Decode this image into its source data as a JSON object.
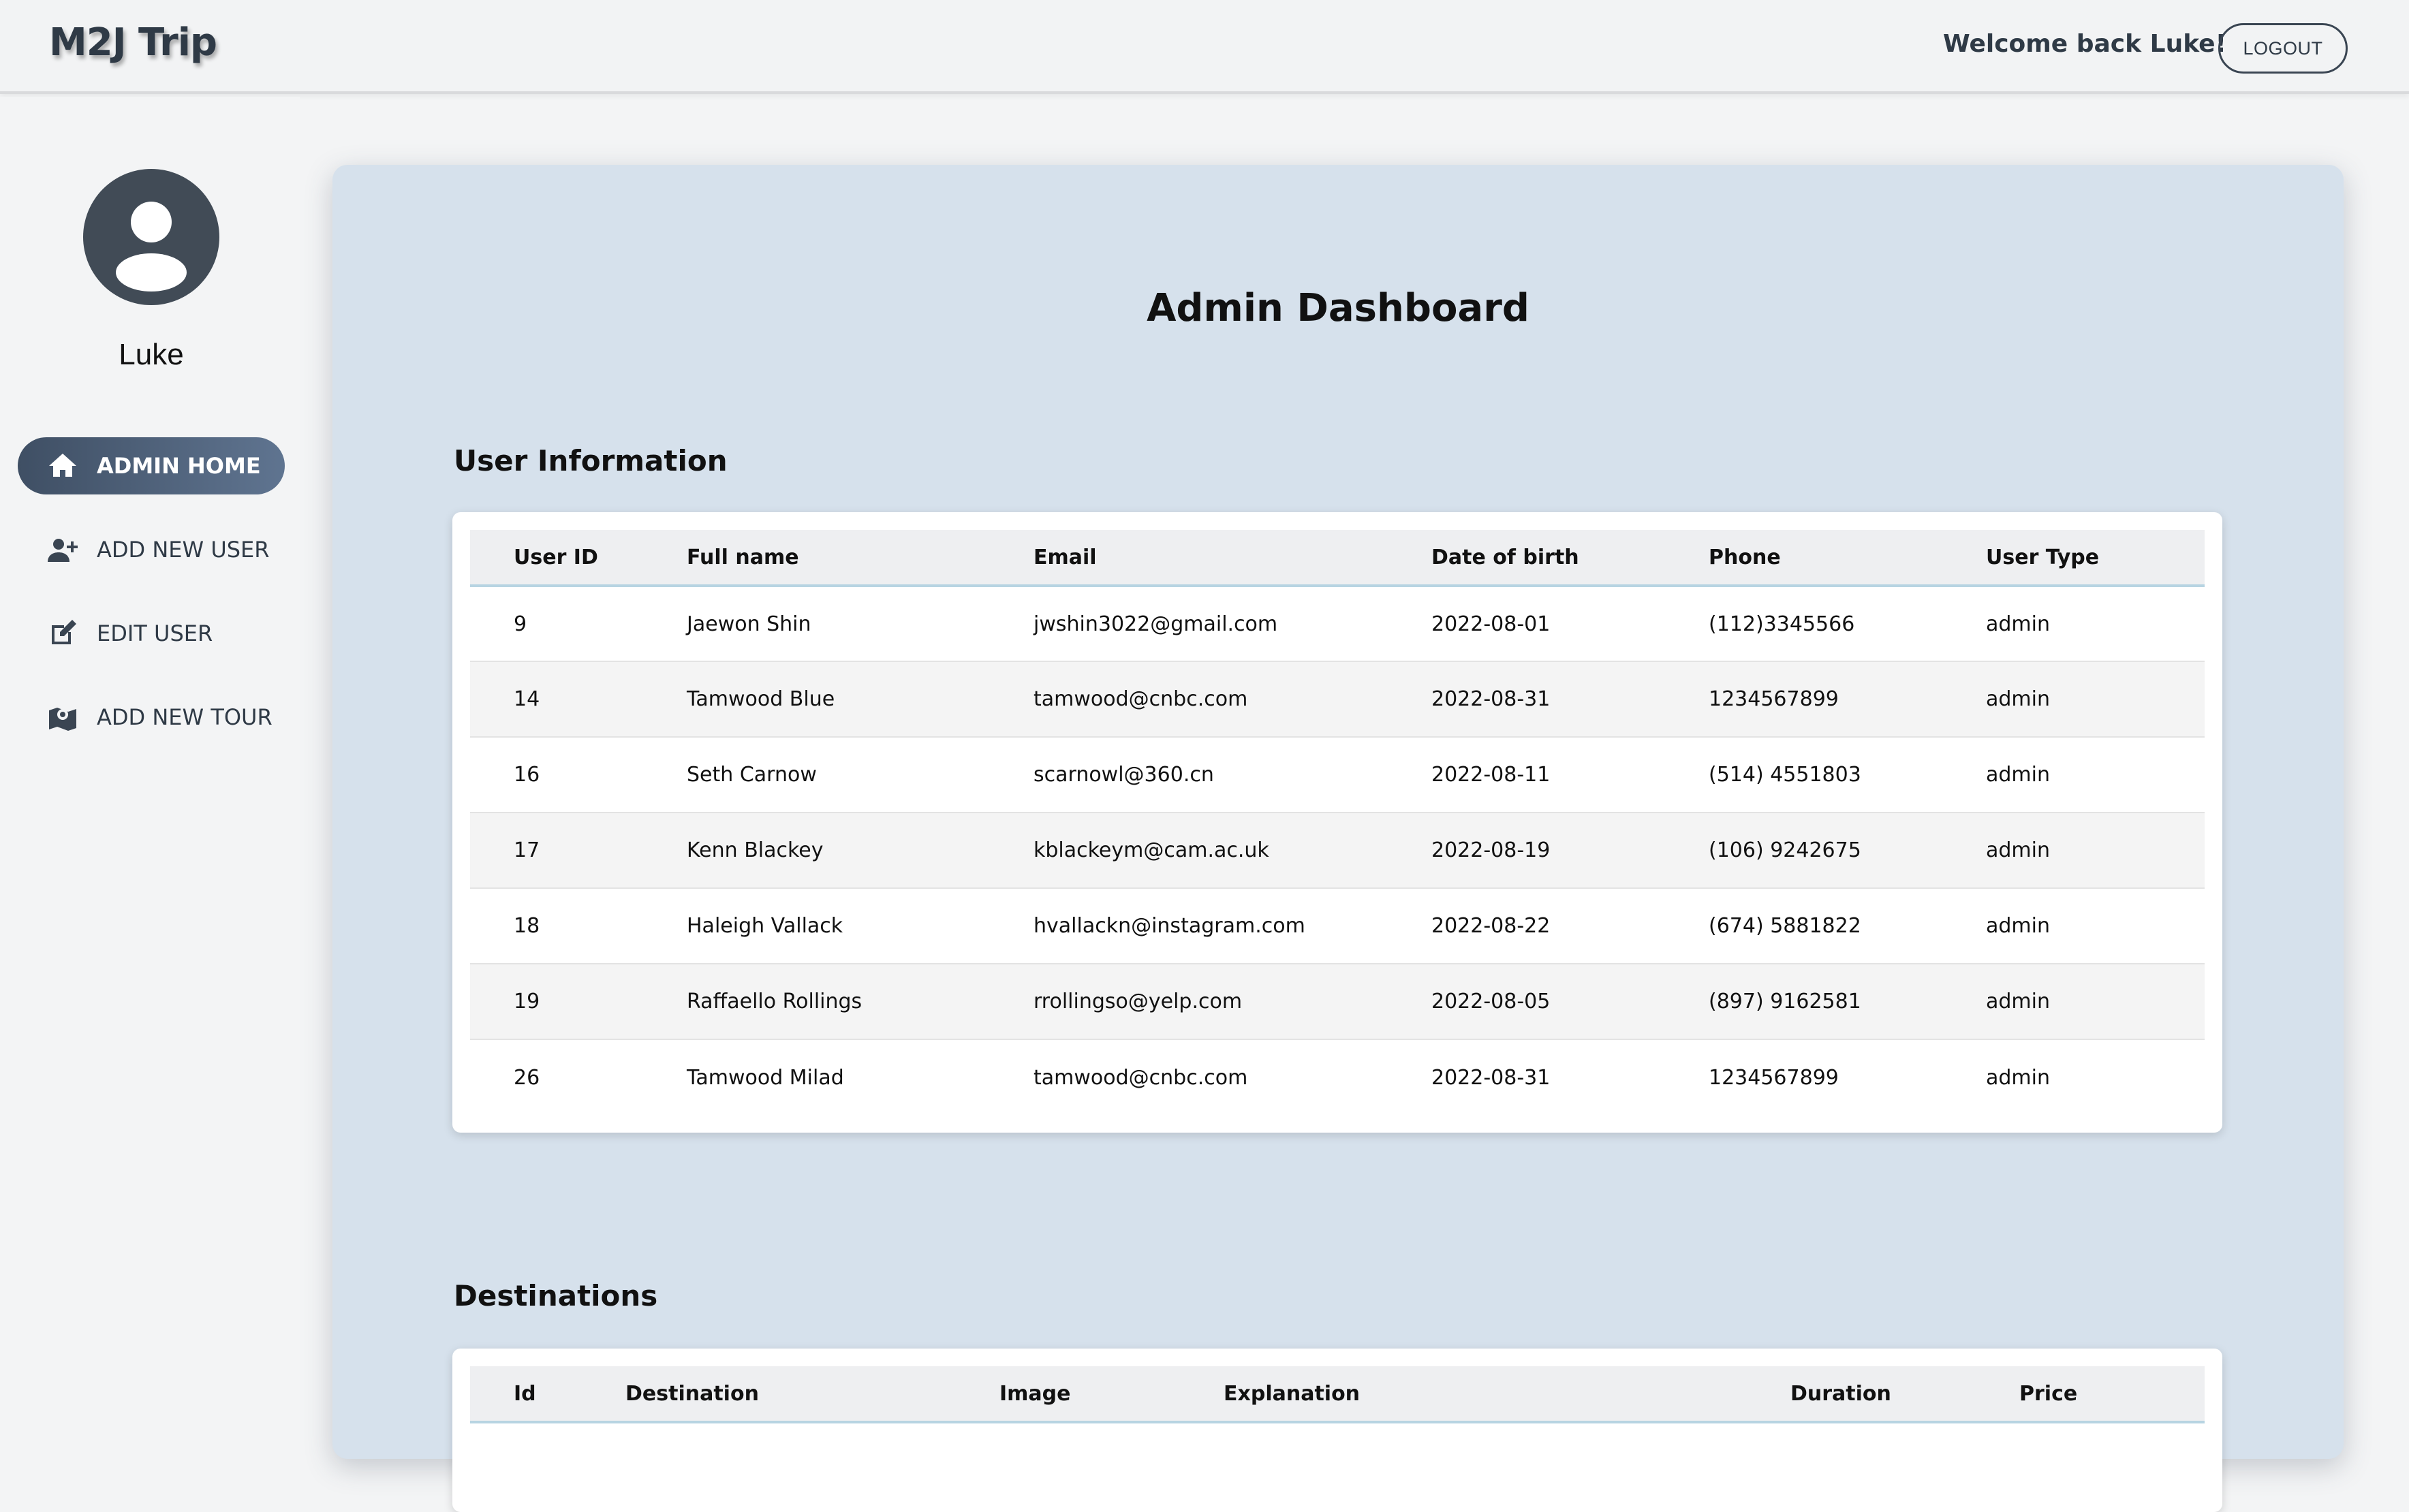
{
  "header": {
    "brand": "M2J Trip",
    "welcome": "Welcome back Luke!",
    "logout_label": "LOGOUT"
  },
  "sidebar": {
    "username": "Luke",
    "items": [
      {
        "label": "ADMIN HOME",
        "icon": "home-icon",
        "active": true
      },
      {
        "label": "ADD NEW USER",
        "icon": "add-user-icon",
        "active": false
      },
      {
        "label": "EDIT USER",
        "icon": "edit-icon",
        "active": false
      },
      {
        "label": "ADD NEW TOUR",
        "icon": "map-marker-icon",
        "active": false
      }
    ]
  },
  "main": {
    "title": "Admin Dashboard",
    "users_section": {
      "title": "User Information",
      "columns": [
        "User ID",
        "Full name",
        "Email",
        "Date of birth",
        "Phone",
        "User Type"
      ],
      "rows": [
        [
          "9",
          "Jaewon Shin",
          "jwshin3022@gmail.com",
          "2022-08-01",
          "(112)3345566",
          "admin"
        ],
        [
          "14",
          "Tamwood Blue",
          "tamwood@cnbc.com",
          "2022-08-31",
          "1234567899",
          "admin"
        ],
        [
          "16",
          "Seth Carnow",
          "scarnowl@360.cn",
          "2022-08-11",
          "(514) 4551803",
          "admin"
        ],
        [
          "17",
          "Kenn Blackey",
          "kblackeym@cam.ac.uk",
          "2022-08-19",
          "(106) 9242675",
          "admin"
        ],
        [
          "18",
          "Haleigh Vallack",
          "hvallackn@instagram.com",
          "2022-08-22",
          "(674) 5881822",
          "admin"
        ],
        [
          "19",
          "Raffaello Rollings",
          "rrollingso@yelp.com",
          "2022-08-05",
          "(897) 9162581",
          "admin"
        ],
        [
          "26",
          "Tamwood Milad",
          "tamwood@cnbc.com",
          "2022-08-31",
          "1234567899",
          "admin"
        ]
      ]
    },
    "destinations_section": {
      "title": "Destinations",
      "columns": [
        "Id",
        "Destination",
        "Image",
        "Explanation",
        "Duration",
        "Price"
      ]
    }
  },
  "colors": {
    "accent": "#4f5f76",
    "panel": "#d6e1ec",
    "header_rule": "#b7d4e2"
  }
}
